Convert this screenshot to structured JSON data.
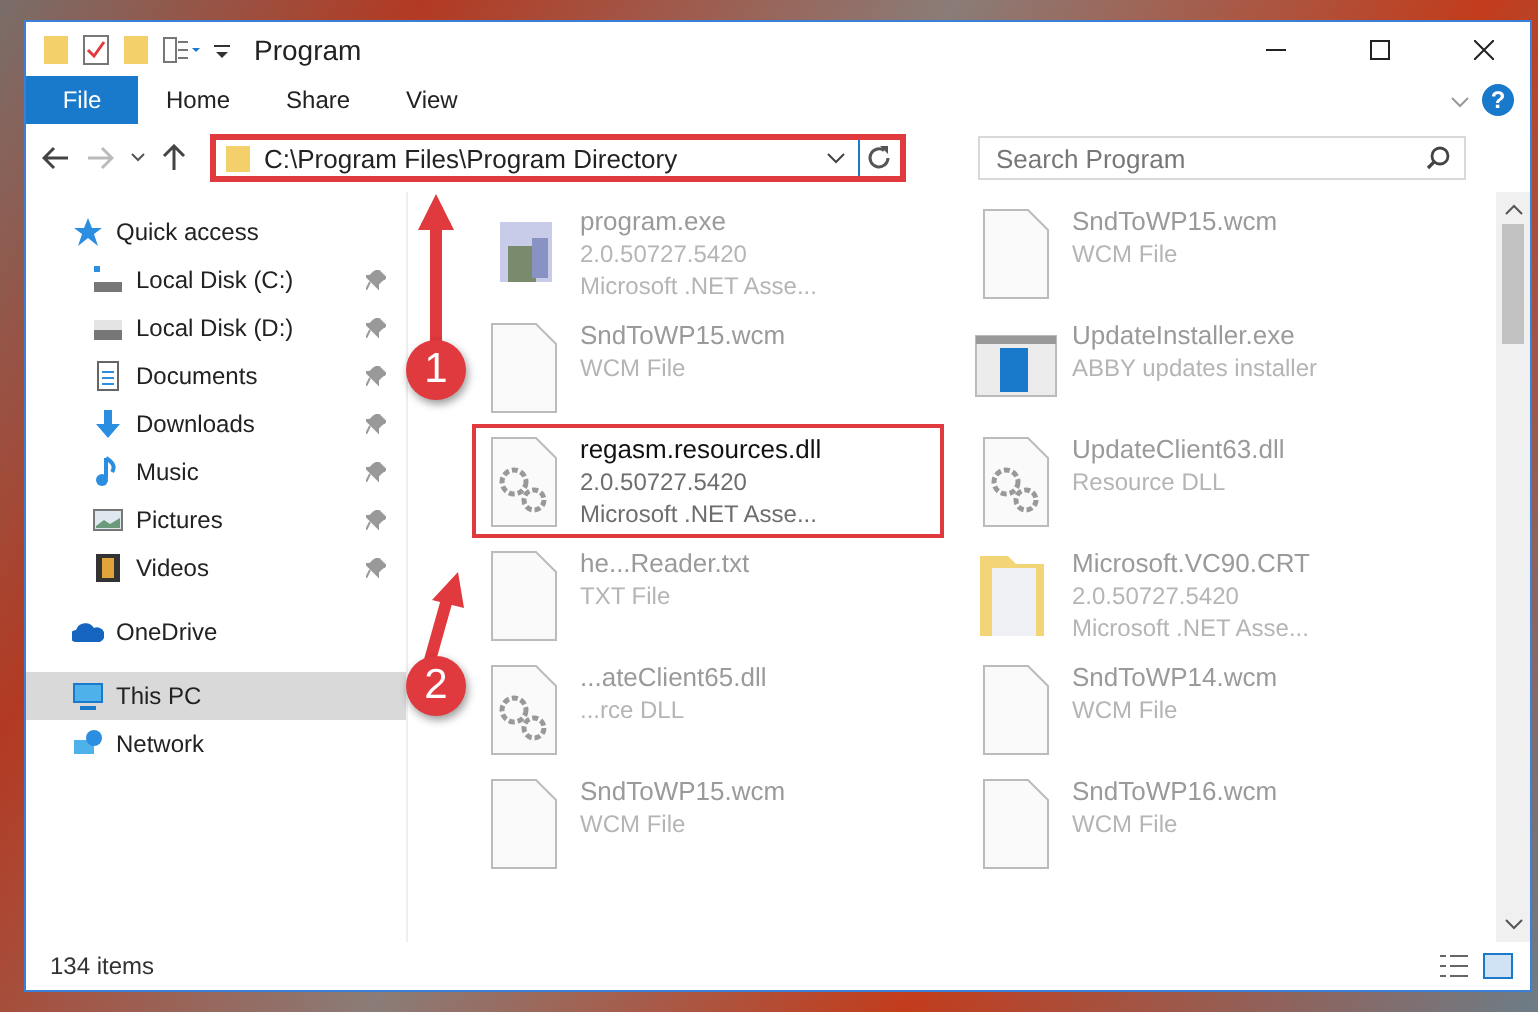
{
  "window": {
    "title": "Program",
    "help": "?"
  },
  "ribbon_tabs": [
    {
      "label": "File",
      "selected": true
    },
    {
      "label": "Home",
      "selected": false
    },
    {
      "label": "Share",
      "selected": false
    },
    {
      "label": "View",
      "selected": false
    }
  ],
  "address_bar": {
    "path": "C:\\Program Files\\Program Directory",
    "highlighted": true
  },
  "search": {
    "placeholder": "Search Program"
  },
  "sidebar": {
    "items": [
      {
        "label": "Quick access",
        "kind": "quick",
        "selected": false,
        "children": [
          {
            "label": "Local Disk (C:)",
            "kind": "disk-c",
            "pinned": true
          },
          {
            "label": "Local Disk (D:)",
            "kind": "disk",
            "pinned": true
          },
          {
            "label": "Documents",
            "kind": "documents",
            "pinned": true
          },
          {
            "label": "Downloads",
            "kind": "downloads",
            "pinned": true
          },
          {
            "label": "Music",
            "kind": "music",
            "pinned": true
          },
          {
            "label": "Pictures",
            "kind": "pictures",
            "pinned": true
          },
          {
            "label": "Videos",
            "kind": "videos",
            "pinned": true
          }
        ]
      },
      {
        "label": "OneDrive",
        "kind": "cloud",
        "selected": false
      },
      {
        "label": "This PC",
        "kind": "pc",
        "selected": true
      },
      {
        "label": "Network",
        "kind": "network",
        "selected": false
      }
    ]
  },
  "files": [
    {
      "name": "program.exe",
      "details": [
        "2.0.50727.5420",
        "Microsoft .NET Asse..."
      ],
      "kind": "exe",
      "highlighted": false
    },
    {
      "name": "SndToWP15.wcm",
      "details": [
        "WCM File"
      ],
      "kind": "doc",
      "highlighted": false
    },
    {
      "name": "SndToWP15.wcm",
      "details": [
        "WCM File"
      ],
      "kind": "doc",
      "highlighted": false
    },
    {
      "name": "UpdateInstaller.exe",
      "details": [
        "ABBY updates installer"
      ],
      "kind": "installer",
      "highlighted": false
    },
    {
      "name": "regasm.resources.dll",
      "details": [
        "2.0.50727.5420",
        "Microsoft .NET Asse..."
      ],
      "kind": "dll",
      "highlighted": true
    },
    {
      "name": "UpdateClient63.dll",
      "details": [
        "Resource DLL"
      ],
      "kind": "dll",
      "highlighted": false
    },
    {
      "name": "he...Reader.txt",
      "details": [
        "TXT File"
      ],
      "kind": "doc",
      "highlighted": false
    },
    {
      "name": "Microsoft.VC90.CRT",
      "details": [
        "2.0.50727.5420",
        "Microsoft .NET Asse..."
      ],
      "kind": "folder",
      "highlighted": false
    },
    {
      "name": "...ateClient65.dll",
      "details": [
        "...rce DLL"
      ],
      "kind": "dll",
      "highlighted": false
    },
    {
      "name": "SndToWP14.wcm",
      "details": [
        "WCM File"
      ],
      "kind": "doc",
      "highlighted": false
    },
    {
      "name": "SndToWP15.wcm",
      "details": [
        "WCM File"
      ],
      "kind": "doc",
      "highlighted": false
    },
    {
      "name": "SndToWP16.wcm",
      "details": [
        "WCM File"
      ],
      "kind": "doc",
      "highlighted": false
    }
  ],
  "status_bar": {
    "count": "134 items"
  },
  "annotations": [
    {
      "number": "1"
    },
    {
      "number": "2"
    }
  ]
}
